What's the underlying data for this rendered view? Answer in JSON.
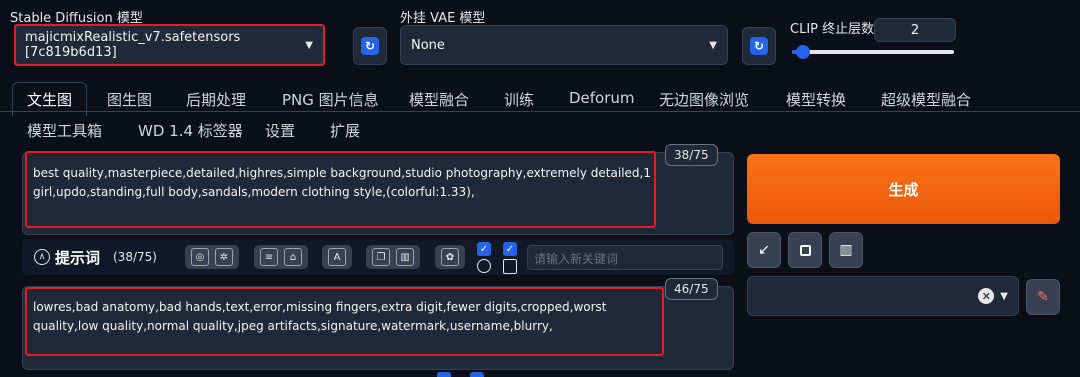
{
  "sd_model": {
    "label": "Stable Diffusion 模型",
    "value": "majicmixRealistic_v7.safetensors [7c819b6d13]"
  },
  "vae": {
    "label": "外挂 VAE 模型",
    "value": "None"
  },
  "clip": {
    "label": "CLIP 终止层数",
    "value": "2"
  },
  "tabs_row1": [
    "文生图",
    "图生图",
    "后期处理",
    "PNG 图片信息",
    "模型融合",
    "训练",
    "Deforum",
    "无边图像浏览",
    "模型转换",
    "超级模型融合"
  ],
  "tabs_row2": [
    "模型工具箱",
    "WD 1.4 标签器",
    "设置",
    "扩展"
  ],
  "positive": {
    "counter": "38/75",
    "text": "best quality,masterpiece,detailed,highres,simple background,studio photography,extremely detailed,1 girl,updo,standing,full body,sandals,modern clothing style,(colorful:1.33),"
  },
  "negative": {
    "counter": "46/75",
    "text": "lowres,bad anatomy,bad hands,text,error,missing fingers,extra digit,fewer digits,cropped,worst quality,low quality,normal quality,jpeg artifacts,signature,watermark,username,blurry,"
  },
  "toolbar": {
    "title": "提示词",
    "count": "(38/75)",
    "keyword_placeholder": "请输入新关键词"
  },
  "generate_label": "生成",
  "icons": {
    "refresh": "refresh-icon",
    "arrow": "arrow-icon",
    "square": "square-icon",
    "trash": "trash-icon",
    "paint": "paint-brush-icon",
    "clear": "clear-icon"
  },
  "colors": {
    "accent": "#2563eb",
    "generate": "#f97316",
    "highlight": "#e11d2a"
  }
}
